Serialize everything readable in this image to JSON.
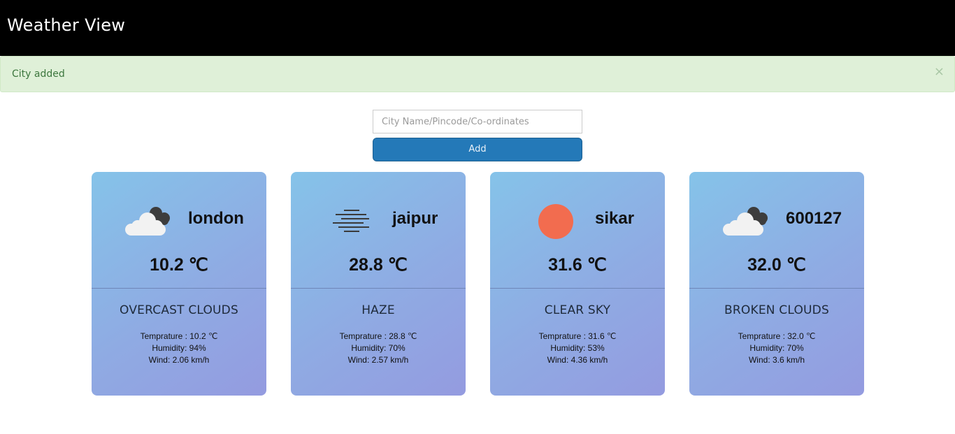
{
  "app": {
    "title": "Weather View"
  },
  "alert": {
    "message": "City added",
    "close_glyph": "×",
    "color": "#dff0d8"
  },
  "search": {
    "value": "",
    "placeholder": "City Name/Pincode/Co-ordinates",
    "button_label": "Add"
  },
  "cards": [
    {
      "icon": "cloudy-icon",
      "city": "london",
      "temp": "10.2 ℃",
      "description": "OVERCAST CLOUDS",
      "temperature_line": "Temprature : 10.2 ℃",
      "humidity_line": "Humidity: 94%",
      "wind_line": "Wind: 2.06 km/h"
    },
    {
      "icon": "haze-icon",
      "city": "jaipur",
      "temp": "28.8 ℃",
      "description": "HAZE",
      "temperature_line": "Temprature : 28.8 ℃",
      "humidity_line": "Humidity: 70%",
      "wind_line": "Wind: 2.57 km/h"
    },
    {
      "icon": "sun-icon",
      "city": "sikar",
      "temp": "31.6 ℃",
      "description": "CLEAR SKY",
      "temperature_line": "Temprature : 31.6 ℃",
      "humidity_line": "Humidity: 53%",
      "wind_line": "Wind: 4.36 km/h"
    },
    {
      "icon": "cloudy-icon",
      "city": "600127",
      "temp": "32.0 ℃",
      "description": "BROKEN CLOUDS",
      "temperature_line": "Temprature : 32.0 ℃",
      "humidity_line": "Humidity: 70%",
      "wind_line": "Wind: 3.6 km/h"
    }
  ],
  "colors": {
    "accent": "#2479b8",
    "sun": "#f26c4f",
    "header": "#000000"
  }
}
